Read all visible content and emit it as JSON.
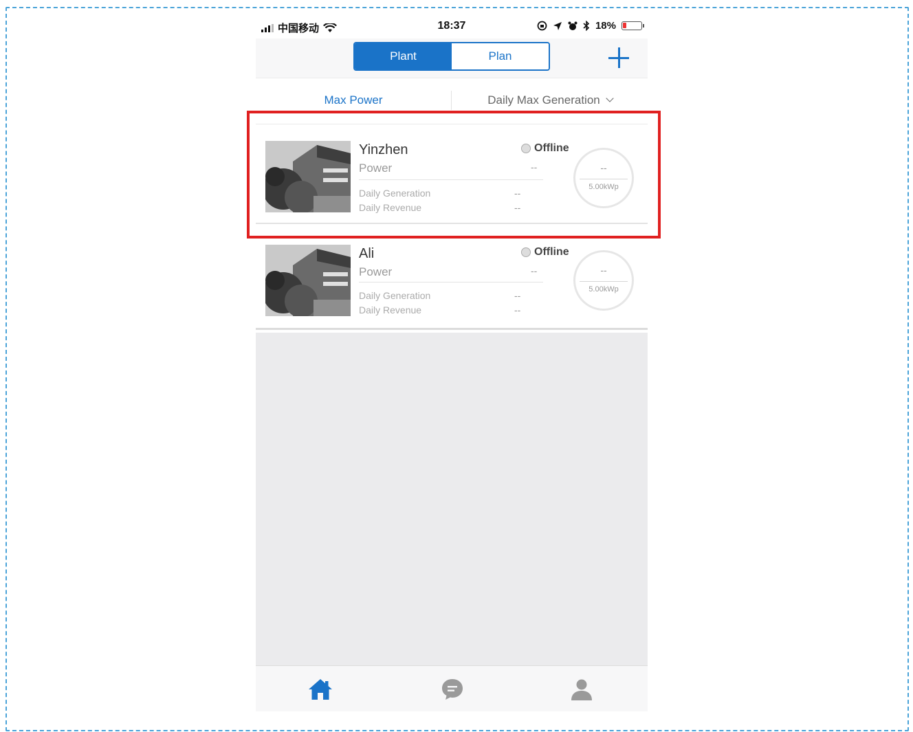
{
  "status_bar": {
    "carrier": "中国移动",
    "time": "18:37",
    "battery": "18%",
    "battery_level": 0.18,
    "icons": [
      "signal-icon",
      "wifi-icon",
      "lock-rotation-icon",
      "location-icon",
      "alarm-icon",
      "bluetooth-icon",
      "battery-icon"
    ]
  },
  "header": {
    "tabs": [
      {
        "label": "Plant",
        "active": true
      },
      {
        "label": "Plan",
        "active": false
      }
    ],
    "add_icon": "plus-icon"
  },
  "sort_bar": {
    "left": "Max Power",
    "right": "Daily Max Generation",
    "dropdown_icon": "chevron-down-icon"
  },
  "plants": [
    {
      "name": "Yinzhen",
      "status": "Offline",
      "power_label": "Power",
      "power_value": "--",
      "daily_generation_label": "Daily Generation",
      "daily_generation_value": "--",
      "daily_revenue_label": "Daily Revenue",
      "daily_revenue_value": "--",
      "ring_value": "--",
      "capacity": "5.00kWp",
      "highlighted": true
    },
    {
      "name": "Ali",
      "status": "Offline",
      "power_label": "Power",
      "power_value": "--",
      "daily_generation_label": "Daily Generation",
      "daily_generation_value": "--",
      "daily_revenue_label": "Daily Revenue",
      "daily_revenue_value": "--",
      "ring_value": "--",
      "capacity": "5.00kWp",
      "highlighted": false
    }
  ],
  "tab_bar": {
    "items": [
      {
        "icon": "home-icon",
        "active": true
      },
      {
        "icon": "message-icon",
        "active": false
      },
      {
        "icon": "user-icon",
        "active": false
      }
    ]
  },
  "colors": {
    "accent": "#1a73c8",
    "highlight": "#e02020",
    "frame": "#4aa3d8",
    "inactive_icon": "#9a9a9a"
  }
}
